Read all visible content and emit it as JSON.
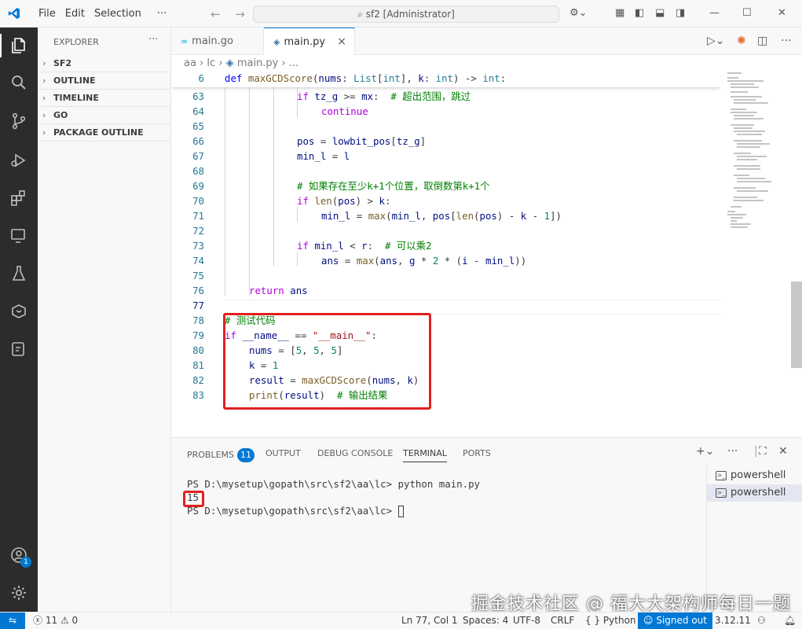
{
  "titlebar": {
    "menu": [
      "File",
      "Edit",
      "Selection",
      "···"
    ],
    "search": "sf2 [Administrator]"
  },
  "sidebar": {
    "title": "EXPLORER",
    "sections": [
      "SF2",
      "OUTLINE",
      "TIMELINE",
      "GO",
      "PACKAGE OUTLINE"
    ]
  },
  "activity": {
    "accounts_badge": "1"
  },
  "tabs": [
    {
      "label": "main.go",
      "icon": "go-file-icon",
      "active": false
    },
    {
      "label": "main.py",
      "icon": "python-file-icon",
      "active": true
    }
  ],
  "breadcrumb": {
    "segments": [
      "aa",
      "lc",
      "main.py",
      "..."
    ]
  },
  "editor": {
    "sticky": {
      "num": "6",
      "text": "def maxGCDScore(nums: List[int], k: int) -> int:"
    },
    "lines": [
      {
        "num": "63",
        "text": "if tz_g >= mx:  # 超出范围，跳过"
      },
      {
        "num": "64",
        "text": "continue"
      },
      {
        "num": "65",
        "text": ""
      },
      {
        "num": "66",
        "text": "pos = lowbit_pos[tz_g]"
      },
      {
        "num": "67",
        "text": "min_l = l"
      },
      {
        "num": "68",
        "text": ""
      },
      {
        "num": "69",
        "text": "# 如果存在至少k+1个位置，取倒数第k+1个"
      },
      {
        "num": "70",
        "text": "if len(pos) > k:"
      },
      {
        "num": "71",
        "text": "min_l = max(min_l, pos[len(pos) - k - 1])"
      },
      {
        "num": "72",
        "text": ""
      },
      {
        "num": "73",
        "text": "if min_l < r:  # 可以乘2"
      },
      {
        "num": "74",
        "text": "ans = max(ans, g * 2 * (i - min_l))"
      },
      {
        "num": "75",
        "text": ""
      },
      {
        "num": "76",
        "text": "return ans"
      },
      {
        "num": "77",
        "text": ""
      },
      {
        "num": "78",
        "text": "# 测试代码"
      },
      {
        "num": "79",
        "text": "if __name__ == \"__main__\":"
      },
      {
        "num": "80",
        "text": "nums = [5, 5, 5]"
      },
      {
        "num": "81",
        "text": "k = 1"
      },
      {
        "num": "82",
        "text": "result = maxGCDScore(nums, k)"
      },
      {
        "num": "83",
        "text": "print(result)  # 输出结果"
      }
    ]
  },
  "panel": {
    "tabs": [
      "PROBLEMS",
      "OUTPUT",
      "DEBUG CONSOLE",
      "TERMINAL",
      "PORTS"
    ],
    "problems_count": "11",
    "active_tab": "TERMINAL",
    "terminal": [
      "PS D:\\mysetup\\gopath\\src\\sf2\\aa\\lc> python main.py",
      "15",
      "PS D:\\mysetup\\gopath\\src\\sf2\\aa\\lc> "
    ],
    "terminal_list": [
      "powershell",
      "powershell"
    ]
  },
  "watermark": "掘金技术社区 @ 福大大架构师每日一题",
  "statusbar": {
    "errors": "11",
    "warnings": "0",
    "position": "Ln 77, Col 1",
    "spaces": "Spaces: 4",
    "encoding": "UTF-8",
    "eol": "CRLF",
    "language": "Python",
    "signed": "Signed out",
    "version": "3.12.11"
  },
  "colors": {
    "accent": "#0078d4",
    "highlight_box": "#e02020"
  }
}
